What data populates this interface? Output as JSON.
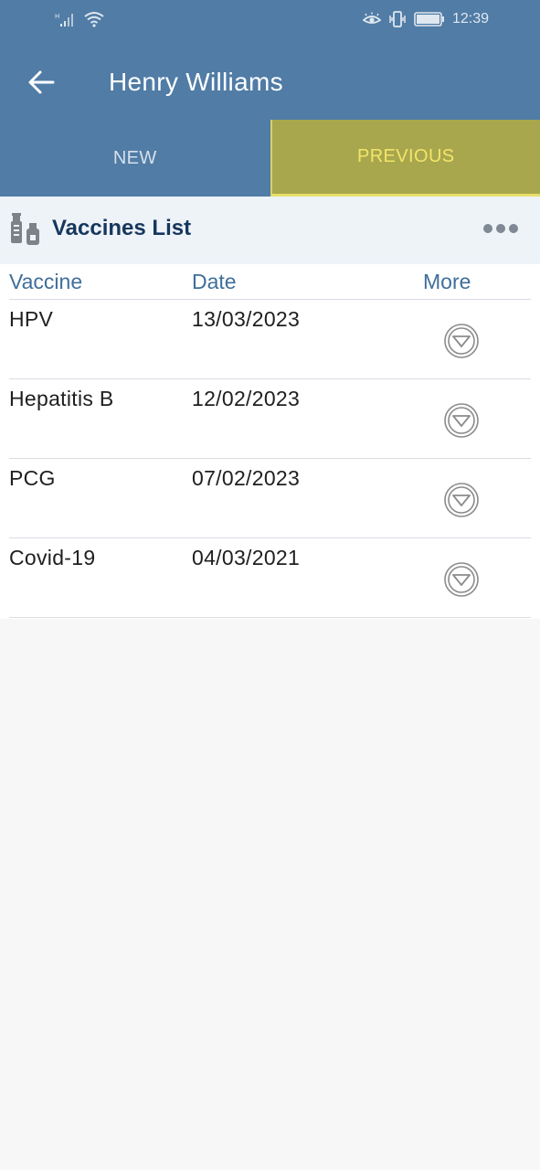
{
  "status_bar": {
    "time": "12:39",
    "icons": [
      "signal-icon",
      "wifi-icon",
      "eye-icon",
      "vibrate-icon",
      "battery-icon"
    ]
  },
  "header": {
    "title": "Henry Williams",
    "back_icon": "back-arrow-icon"
  },
  "tabs": [
    {
      "label": "NEW",
      "active": false
    },
    {
      "label": "PREVIOUS",
      "active": true
    }
  ],
  "vaccines_list": {
    "title": "Vaccines List",
    "icon": "vaccine-icon",
    "menu_icon": "more-options-icon",
    "columns": [
      "Vaccine",
      "Date",
      "More"
    ],
    "rows": [
      {
        "vaccine": "HPV",
        "date": "13/03/2023"
      },
      {
        "vaccine": "Hepatitis B",
        "date": "12/02/2023"
      },
      {
        "vaccine": "PCG",
        "date": "07/02/2023"
      },
      {
        "vaccine": "Covid-19",
        "date": "04/03/2021"
      }
    ]
  },
  "colors": {
    "primary": "#507ca6",
    "active_tab": "#a8a74d",
    "active_tab_text": "#f3e56a",
    "header_title": "#16375d",
    "column_header": "#3f6f9b"
  }
}
